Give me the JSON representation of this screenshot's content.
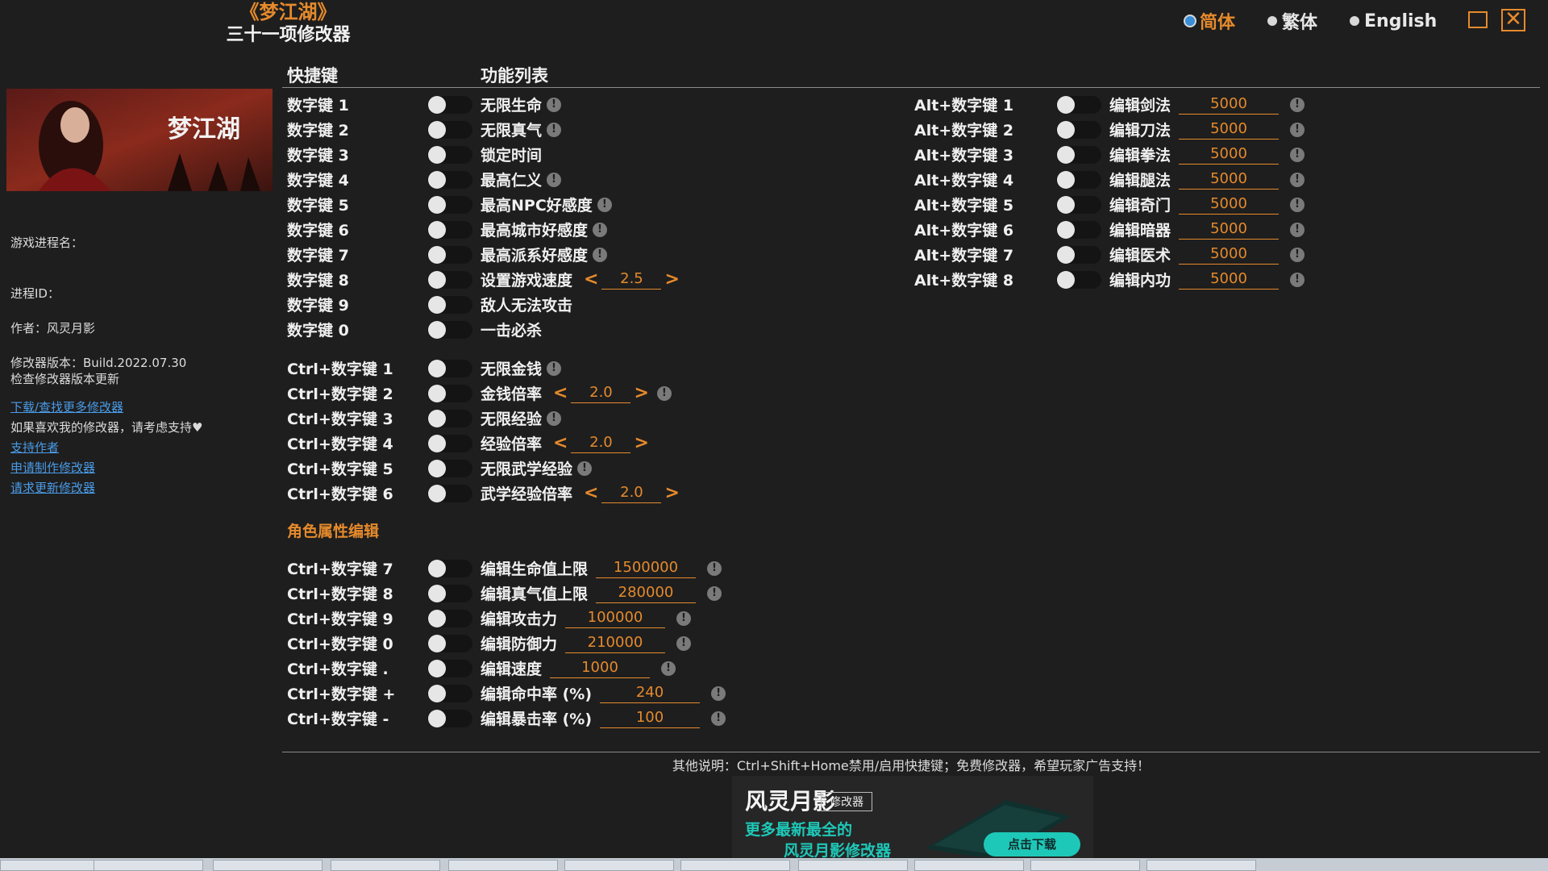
{
  "header": {
    "game_title": "《梦江湖》",
    "trainer_name": "三十一项修改器"
  },
  "language": {
    "selected": "简体",
    "options": [
      "简体",
      "繁体",
      "English"
    ]
  },
  "window": {
    "minimize_icon": "minimize-icon",
    "close_icon": "close-icon"
  },
  "sidebar": {
    "banner_text": "梦江湖",
    "process_name_label": "游戏进程名：",
    "process_id_label": "进程ID：",
    "author": "作者：风灵月影",
    "version": "修改器版本：Build.2022.07.30",
    "check_update": "检查修改器版本更新",
    "download_more": "下载/查找更多修改器",
    "support_note": "如果喜欢我的修改器，请考虑支持♥",
    "support_author": "支持作者",
    "request_make": "申请制作修改器",
    "request_update": "请求更新修改器"
  },
  "columns": {
    "hotkey": "快捷键",
    "function_list": "功能列表"
  },
  "left_features": [
    {
      "hotkey": "数字键 1",
      "name": "无限生命",
      "info": true
    },
    {
      "hotkey": "数字键 2",
      "name": "无限真气",
      "info": true
    },
    {
      "hotkey": "数字键 3",
      "name": "锁定时间",
      "info": false
    },
    {
      "hotkey": "数字键 4",
      "name": "最高仁义",
      "info": true
    },
    {
      "hotkey": "数字键 5",
      "name": "最高NPC好感度",
      "info": true
    },
    {
      "hotkey": "数字键 6",
      "name": "最高城市好感度",
      "info": true
    },
    {
      "hotkey": "数字键 7",
      "name": "最高派系好感度",
      "info": true
    },
    {
      "hotkey": "数字键 8",
      "name": "设置游戏速度",
      "info": false,
      "stepper": "2.5"
    },
    {
      "hotkey": "数字键 9",
      "name": "敌人无法攻击",
      "info": false
    },
    {
      "hotkey": "数字键 0",
      "name": "一击必杀",
      "info": false
    }
  ],
  "ctrl_features": [
    {
      "hotkey": "Ctrl+数字键 1",
      "name": "无限金钱",
      "info": true
    },
    {
      "hotkey": "Ctrl+数字键 2",
      "name": "金钱倍率",
      "info": true,
      "stepper": "2.0"
    },
    {
      "hotkey": "Ctrl+数字键 3",
      "name": "无限经验",
      "info": true
    },
    {
      "hotkey": "Ctrl+数字键 4",
      "name": "经验倍率",
      "info": false,
      "stepper": "2.0"
    },
    {
      "hotkey": "Ctrl+数字键 5",
      "name": "无限武学经验",
      "info": true
    },
    {
      "hotkey": "Ctrl+数字键 6",
      "name": "武学经验倍率",
      "info": false,
      "stepper": "2.0"
    }
  ],
  "section": {
    "title": "角色属性编辑"
  },
  "attr_features": [
    {
      "hotkey": "Ctrl+数字键 7",
      "name": "编辑生命值上限",
      "value": "1500000"
    },
    {
      "hotkey": "Ctrl+数字键 8",
      "name": "编辑真气值上限",
      "value": "280000"
    },
    {
      "hotkey": "Ctrl+数字键 9",
      "name": "编辑攻击力",
      "value": "100000"
    },
    {
      "hotkey": "Ctrl+数字键 0",
      "name": "编辑防御力",
      "value": "210000"
    },
    {
      "hotkey": "Ctrl+数字键 .",
      "name": "编辑速度",
      "value": "1000"
    },
    {
      "hotkey": "Ctrl+数字键 +",
      "name": "编辑命中率 (%)",
      "value": "240"
    },
    {
      "hotkey": "Ctrl+数字键 -",
      "name": "编辑暴击率 (%)",
      "value": "100"
    }
  ],
  "alt_features": [
    {
      "hotkey": "Alt+数字键 1",
      "name": "编辑剑法",
      "value": "5000"
    },
    {
      "hotkey": "Alt+数字键 2",
      "name": "编辑刀法",
      "value": "5000"
    },
    {
      "hotkey": "Alt+数字键 3",
      "name": "编辑拳法",
      "value": "5000"
    },
    {
      "hotkey": "Alt+数字键 4",
      "name": "编辑腿法",
      "value": "5000"
    },
    {
      "hotkey": "Alt+数字键 5",
      "name": "编辑奇门",
      "value": "5000"
    },
    {
      "hotkey": "Alt+数字键 6",
      "name": "编辑暗器",
      "value": "5000"
    },
    {
      "hotkey": "Alt+数字键 7",
      "name": "编辑医术",
      "value": "5000"
    },
    {
      "hotkey": "Alt+数字键 8",
      "name": "编辑内功",
      "value": "5000"
    }
  ],
  "footer": {
    "note": "其他说明：Ctrl+Shift+Home禁用/启用快捷键；免费修改器，希望玩家广告支持！"
  },
  "ad": {
    "logo": "风灵月影",
    "tag": "修改器",
    "line1": "更多最新最全的",
    "line2": "风灵月影修改器",
    "button": "点击下载"
  },
  "icons": {
    "info": "info-icon",
    "toggle": "toggle-switch",
    "stepper_left": "chevron-left-icon",
    "stepper_right": "chevron-right-icon"
  },
  "colors": {
    "accent": "#e58a2c",
    "background": "#1e1e1e",
    "link": "#4a9be8",
    "ad_accent": "#1ec8b8"
  }
}
